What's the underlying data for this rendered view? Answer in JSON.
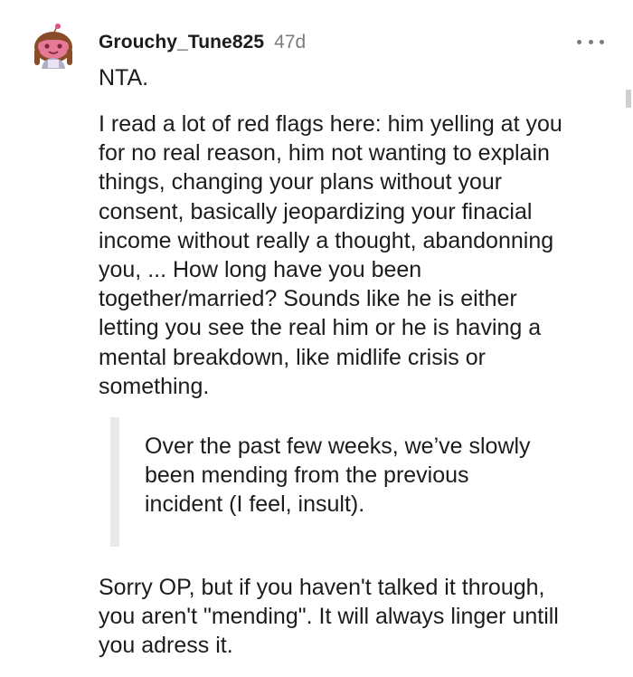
{
  "comment": {
    "username": "Grouchy_Tune825",
    "age": "47d",
    "more_icon": "ellipsis-icon",
    "avatar_icon": "snoo-avatar-icon",
    "lines_nta": "NTA.",
    "paragraph1": [
      "I read a lot of red flags here: him yelling at you",
      "for no real reason, him not wanting to explain",
      "things, changing your plans without your",
      "consent, basically jeopardizing your finacial",
      "income without really a thought, abandonning",
      "you, ... How long have you been",
      "together/married? Sounds like he is either",
      "letting you see the real him or he is having a",
      "mental breakdown, like midlife crisis or",
      "something."
    ],
    "quote": [
      "Over the past few weeks, we’ve slowly",
      "been mending from the previous",
      "incident (I feel, insult)."
    ],
    "paragraph2": [
      "Sorry OP, but if you haven't talked it through,",
      "you aren't \"mending\". It will always linger untill",
      "you adress it."
    ]
  },
  "colors": {
    "text": "#1c1c1c",
    "meta": "#7c7c7c",
    "quote_bar": "#e9e9e9",
    "avatar_pink": "#e0527a",
    "avatar_hair": "#8a4b28"
  }
}
